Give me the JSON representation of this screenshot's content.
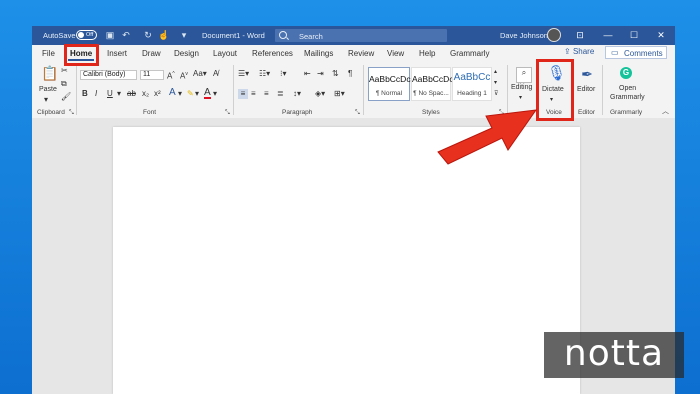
{
  "titlebar": {
    "autosave_label": "AutoSave",
    "autosave_state": "Off",
    "document_title": "Document1 - Word",
    "search_placeholder": "Search",
    "user_name": "Dave Johnson"
  },
  "tabs": [
    "File",
    "Home",
    "Insert",
    "Draw",
    "Design",
    "Layout",
    "References",
    "Mailings",
    "Review",
    "View",
    "Help",
    "Grammarly"
  ],
  "active_tab": "Home",
  "tab_actions": {
    "share": "Share",
    "comments": "Comments"
  },
  "ribbon": {
    "clipboard": {
      "paste": "Paste",
      "group": "Clipboard"
    },
    "font": {
      "name": "Calibri (Body)",
      "size": "11",
      "group": "Font"
    },
    "paragraph": {
      "group": "Paragraph"
    },
    "styles": {
      "items": [
        {
          "preview": "AaBbCcDc",
          "name": "¶ Normal"
        },
        {
          "preview": "AaBbCcDc",
          "name": "¶ No Spac..."
        },
        {
          "preview": "AaBbCc",
          "name": "Heading 1"
        }
      ],
      "group": "Styles"
    },
    "editing": {
      "label": "Editing"
    },
    "voice": {
      "dictate": "Dictate",
      "group": "Voice"
    },
    "editor": {
      "label": "Editor",
      "group": "Editor"
    },
    "grammarly": {
      "label_line1": "Open",
      "label_line2": "Grammarly",
      "group": "Grammarly"
    }
  },
  "watermark": "notta",
  "colors": {
    "titlebar": "#2b579a",
    "highlight": "#e0261b",
    "desktop": "#1e90e8"
  }
}
